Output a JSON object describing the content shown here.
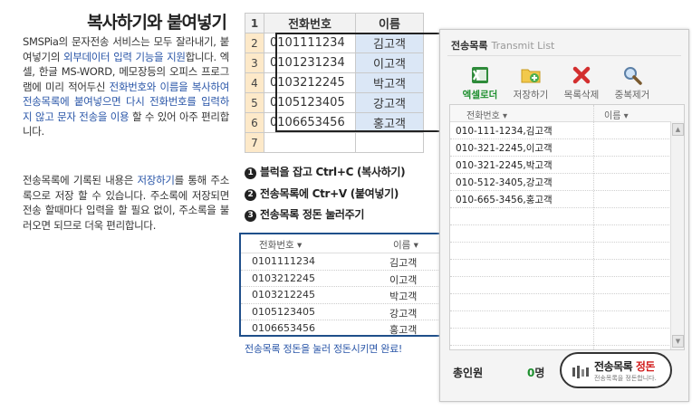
{
  "article": {
    "title": "복사하기와 붙여넣기",
    "p1_parts": [
      {
        "t": "SMSPia의 문자전송 서비스는 모두 잘라내기, 붙여넣기의 ",
        "hl": false
      },
      {
        "t": "외부데이터 입력 기능을 지원",
        "hl": true
      },
      {
        "t": "합니다. 엑셀, 한글 MS-WORD, 메모장등의 오피스 프로그램에 미리 적어두신 ",
        "hl": false
      },
      {
        "t": "전화번호와 이름을 복사하여 전송목록에 붙여넣으면 다시 전화번호를 입력하지 않고 문자 전송을 이용",
        "hl": true
      },
      {
        "t": " 할 수 있어 아주 편리합니다.",
        "hl": false
      }
    ],
    "p2_parts": [
      {
        "t": "전송목록에 기록된 내용은 ",
        "hl": false
      },
      {
        "t": "저장하기",
        "hl": true
      },
      {
        "t": "를 통해 주소록으로 저장 할 수 있습니다. 주소록에 저장되면 전송 할때마다 입력을 할 필요 없이, 주소록을 불러오면 되므로 더욱 편리합니다.",
        "hl": false
      }
    ]
  },
  "sheet": {
    "header": {
      "row": "1",
      "phone": "전화번호",
      "name": "이름"
    },
    "rows": [
      {
        "row": "2",
        "phone": "0101111234",
        "name": "김고객"
      },
      {
        "row": "3",
        "phone": "0101231234",
        "name": "이고객"
      },
      {
        "row": "4",
        "phone": "0103212245",
        "name": "박고객"
      },
      {
        "row": "5",
        "phone": "0105123405",
        "name": "강고객"
      },
      {
        "row": "6",
        "phone": "0106653456",
        "name": "홍고객"
      },
      {
        "row": "7",
        "phone": "",
        "name": ""
      }
    ]
  },
  "steps": [
    {
      "num": "1",
      "text": "블럭을 잡고 Ctrl+C (복사하기)"
    },
    {
      "num": "2",
      "text": "전송목록에 Ctr+V (붙여넣기)"
    },
    {
      "num": "3",
      "text": "전송목록 정돈 눌러주기"
    }
  ],
  "result": {
    "col_phone": "전화번호 ▾",
    "col_name": "이름 ▾",
    "rows": [
      {
        "phone": "0101111234",
        "name": "김고객"
      },
      {
        "phone": "0103212245",
        "name": "이고객"
      },
      {
        "phone": "0103212245",
        "name": "박고객"
      },
      {
        "phone": "0105123405",
        "name": "강고객"
      },
      {
        "phone": "0106653456",
        "name": "홍고객"
      }
    ],
    "done_text": "전송목록 정돈을 눌러 정돈시키면 완료!"
  },
  "app": {
    "title": "전송목록",
    "title_en": "Transmit  List",
    "toolbar": [
      {
        "label": "엑셀로더",
        "icon": "excel-icon"
      },
      {
        "label": "저장하기",
        "icon": "folder-add-icon"
      },
      {
        "label": "목록삭제",
        "icon": "delete-x-icon"
      },
      {
        "label": "중복제거",
        "icon": "magnifier-icon"
      }
    ],
    "col_phone": "전화번호 ▾",
    "col_name": "이름 ▾",
    "list": [
      "010-111-1234,김고객",
      "010-321-2245,이고객",
      "010-321-2245,박고객",
      "010-512-3405,강고객",
      "010-665-3456,홍고객",
      "",
      "",
      "",
      "",
      "",
      "",
      "",
      ""
    ],
    "total_label": "총인원",
    "count": "0",
    "count_unit": "명",
    "sort_button": {
      "label_main": "전송목록 ",
      "label_red": "정돈",
      "sub": "전송목록을 정돈합니다."
    },
    "colors": {
      "accent_green": "#1d8f2e",
      "accent_red": "#d21c1c",
      "frame_blue": "#1f4f8a"
    }
  }
}
